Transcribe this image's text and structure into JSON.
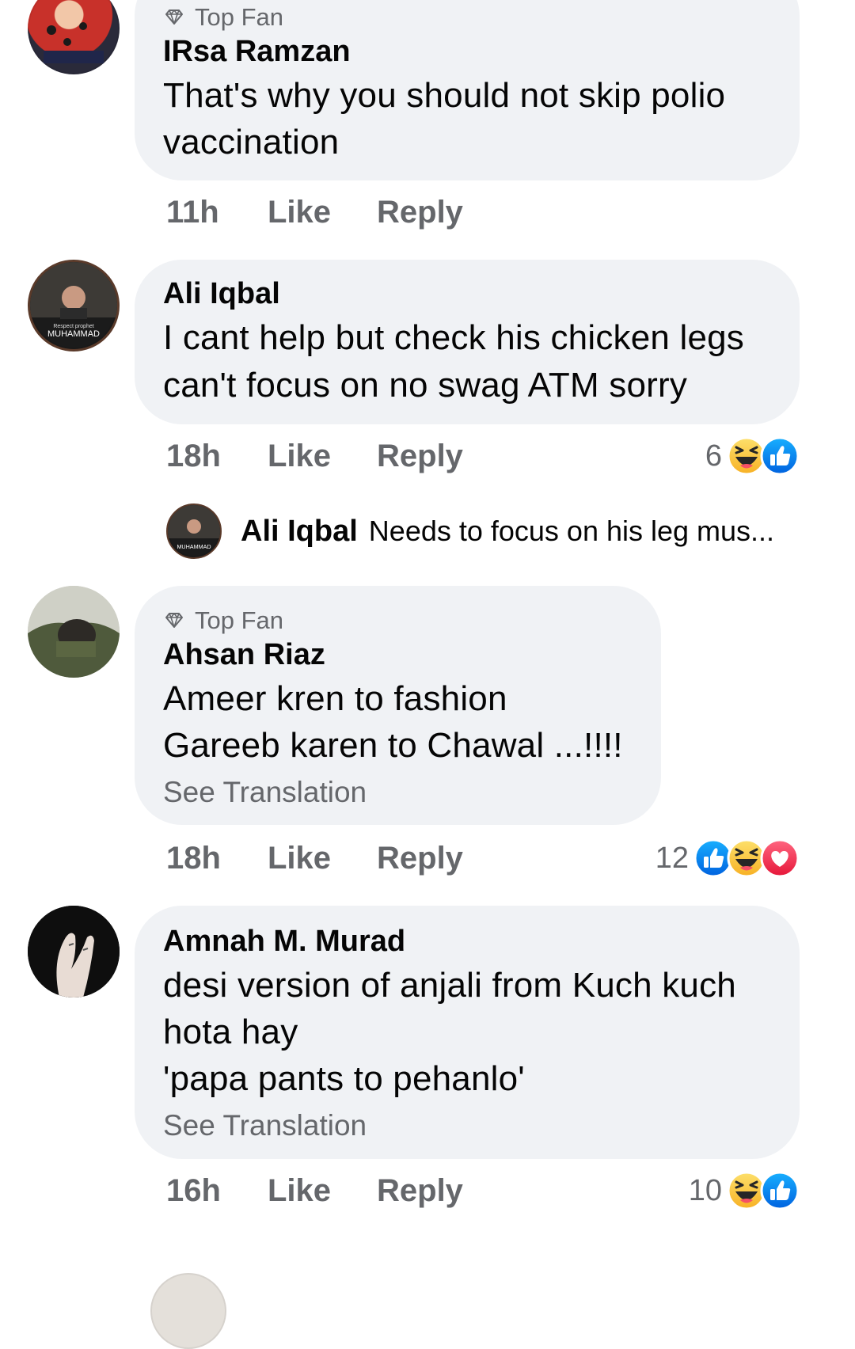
{
  "comments": [
    {
      "badge": "Top Fan",
      "author": "IRsa Ramzan",
      "lines": [
        "That's why you should not skip polio",
        "vaccination"
      ],
      "time": "11h",
      "like": "Like",
      "reply": "Reply"
    },
    {
      "author": "Ali Iqbal",
      "lines": [
        "I cant help but check his chicken legs",
        "can't focus on no swag ATM sorry"
      ],
      "time": "18h",
      "like": "Like",
      "reply": "Reply",
      "reaction_count": "6",
      "reactions": [
        "haha-icon",
        "like-icon"
      ],
      "reply_preview": {
        "author": "Ali Iqbal",
        "text": "Needs to focus on his leg mus..."
      },
      "avatar_text": [
        "Respect prophet",
        "MUHAMMAD"
      ]
    },
    {
      "badge": "Top Fan",
      "author": "Ahsan Riaz",
      "lines": [
        "Ameer kren to fashion",
        "Gareeb karen to Chawal ...!!!!"
      ],
      "see_translation": "See Translation",
      "time": "18h",
      "like": "Like",
      "reply": "Reply",
      "reaction_count": "12",
      "reactions": [
        "like-icon",
        "haha-icon",
        "love-icon"
      ]
    },
    {
      "author": "Amnah M. Murad",
      "lines": [
        "desi version of anjali from Kuch kuch",
        "hota hay",
        "'papa pants to pehanlo'"
      ],
      "see_translation": "See Translation",
      "time": "16h",
      "like": "Like",
      "reply": "Reply",
      "reaction_count": "10",
      "reactions": [
        "haha-icon",
        "like-icon"
      ]
    }
  ],
  "colors": {
    "bubble": "#f0f2f5",
    "secondary_text": "#65676b",
    "like_blue": "#1877f2",
    "love_red": "#f33e58",
    "haha_yellow": "#f7b125"
  }
}
